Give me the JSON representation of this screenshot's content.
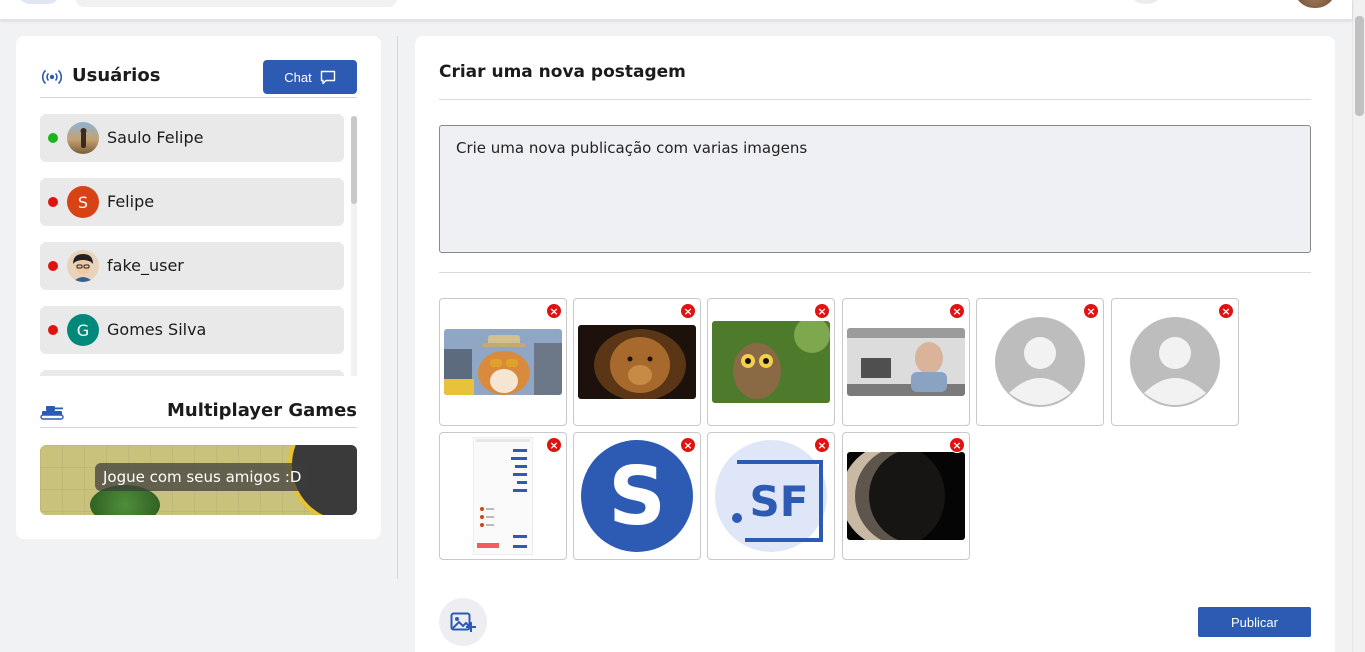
{
  "topbar": {
    "logo_icon": "app-logo",
    "search_icon": "search-icon",
    "avatar_icon": "profile-avatar"
  },
  "users": {
    "title": "Usuários",
    "chat_label": "Chat",
    "items": [
      {
        "name": "Saulo Felipe",
        "status": "online",
        "status_color": "#1db31d",
        "avatar_type": "photo",
        "avatar_letter": ""
      },
      {
        "name": "Felipe",
        "status": "offline",
        "status_color": "#e01212",
        "avatar_type": "letter",
        "avatar_letter": "S",
        "avatar_color": "#d84315"
      },
      {
        "name": "fake_user",
        "status": "offline",
        "status_color": "#e01212",
        "avatar_type": "photo",
        "avatar_letter": ""
      },
      {
        "name": "Gomes Silva",
        "status": "offline",
        "status_color": "#e01212",
        "avatar_type": "letter",
        "avatar_letter": "G",
        "avatar_color": "#00897b"
      }
    ]
  },
  "games": {
    "title": "Multiplayer Games",
    "banner_text": "Jogue com seus amigos :D"
  },
  "post": {
    "title": "Criar uma nova postagem",
    "text": "Crie uma nova publicação  com varias imagens",
    "images": [
      {
        "name": "corgi-image",
        "kind": "photo"
      },
      {
        "name": "lion-image",
        "kind": "photo"
      },
      {
        "name": "owl-image",
        "kind": "photo"
      },
      {
        "name": "meme-image",
        "kind": "photo"
      },
      {
        "name": "placeholder-avatar-image",
        "kind": "placeholder"
      },
      {
        "name": "placeholder-avatar-image",
        "kind": "placeholder"
      },
      {
        "name": "chat-screenshot-image",
        "kind": "screenshot"
      },
      {
        "name": "s-logo-image",
        "kind": "logo"
      },
      {
        "name": "sf-logo-image",
        "kind": "logo"
      },
      {
        "name": "planet-image",
        "kind": "photo"
      }
    ],
    "remove_symbol": "×",
    "publish_label": "Publicar",
    "add_image_icon": "add-image-icon"
  },
  "colors": {
    "primary": "#2d5bb4",
    "online": "#1db31d",
    "offline": "#e01212",
    "remove": "#e01212"
  }
}
